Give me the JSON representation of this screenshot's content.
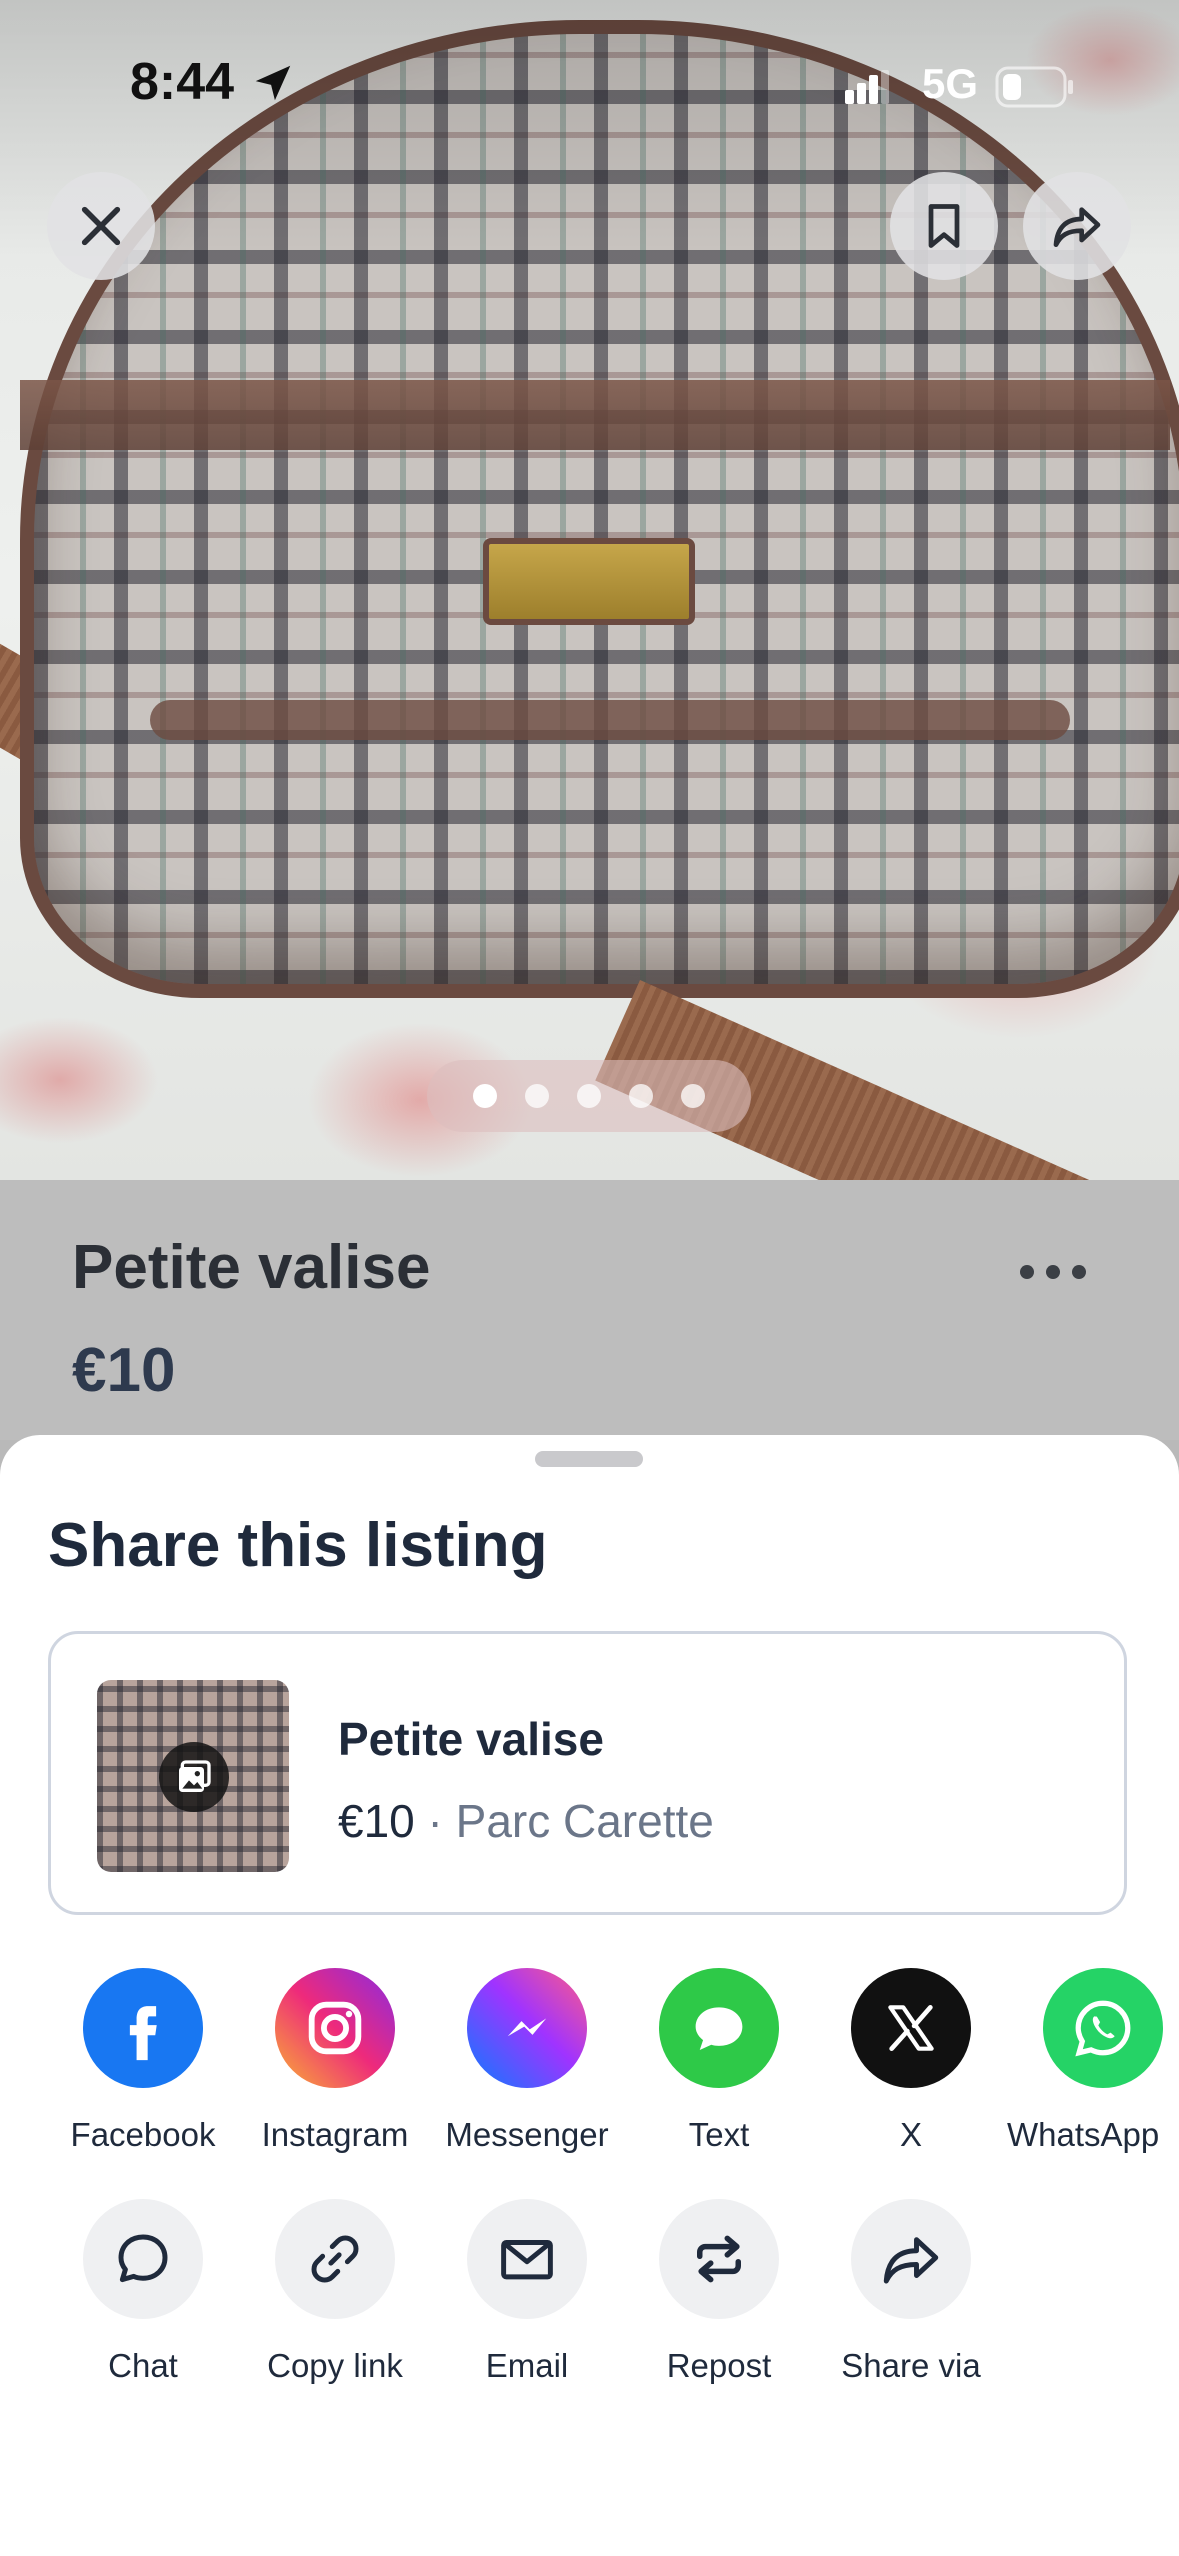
{
  "status_bar": {
    "time": "8:44",
    "network": "5G"
  },
  "listing": {
    "title": "Petite valise",
    "price": "€10"
  },
  "share_sheet": {
    "title": "Share this listing",
    "preview": {
      "title": "Petite valise",
      "price": "€10",
      "separator": " · ",
      "location": "Parc Carette"
    },
    "apps": [
      {
        "label": "Facebook",
        "icon": "facebook-icon",
        "color": "#1877f2"
      },
      {
        "label": "Instagram",
        "icon": "instagram-icon",
        "color": "#e1306c"
      },
      {
        "label": "Messenger",
        "icon": "messenger-icon",
        "color": "#7b61ff"
      },
      {
        "label": "Text",
        "icon": "message-bubble-icon",
        "color": "#2ec948"
      },
      {
        "label": "X",
        "icon": "x-logo-icon",
        "color": "#111111"
      },
      {
        "label": "WhatsApp",
        "icon": "whatsapp-icon",
        "color": "#25d366"
      }
    ],
    "actions": [
      {
        "label": "Chat",
        "icon": "chat-bubble-icon"
      },
      {
        "label": "Copy link",
        "icon": "link-icon"
      },
      {
        "label": "Email",
        "icon": "envelope-icon"
      },
      {
        "label": "Repost",
        "icon": "repost-icon"
      },
      {
        "label": "Share via",
        "icon": "share-arrow-icon"
      }
    ]
  },
  "photo_pager": {
    "count": 5,
    "active_index": 0
  }
}
